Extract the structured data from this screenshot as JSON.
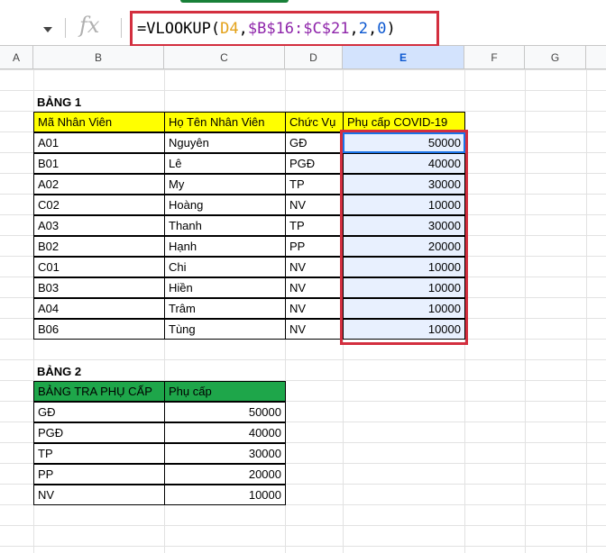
{
  "formula_bar": {
    "icon": "fx-icon",
    "formula_parts": [
      "=VLOOKUP(",
      "D4",
      ",",
      "$B$16:$C$21",
      ",",
      "2",
      ",",
      "0",
      ")"
    ]
  },
  "columns": [
    "A",
    "B",
    "C",
    "D",
    "E",
    "F",
    "G"
  ],
  "table1": {
    "title": "BẢNG 1",
    "headers": [
      "Mã Nhân Viên",
      "Họ Tên Nhân Viên",
      "Chức Vụ",
      "Phụ cấp COVID-19"
    ],
    "rows": [
      [
        "A01",
        "Nguyên",
        "GĐ",
        "50000"
      ],
      [
        "B01",
        "Lê",
        "PGĐ",
        "40000"
      ],
      [
        "A02",
        "My",
        "TP",
        "30000"
      ],
      [
        "C02",
        "Hoàng",
        "NV",
        "10000"
      ],
      [
        "A03",
        "Thanh",
        "TP",
        "30000"
      ],
      [
        "B02",
        "Hạnh",
        "PP",
        "20000"
      ],
      [
        "C01",
        "Chi",
        "NV",
        "10000"
      ],
      [
        "B03",
        "Hiền",
        "NV",
        "10000"
      ],
      [
        "A04",
        "Trâm",
        "NV",
        "10000"
      ],
      [
        "B06",
        "Tùng",
        "NV",
        "10000"
      ]
    ]
  },
  "table2": {
    "title": "BẢNG 2",
    "headers": [
      "BẢNG TRA PHỤ CẤP",
      "Phụ cấp"
    ],
    "rows": [
      [
        "GĐ",
        "50000"
      ],
      [
        "PGĐ",
        "40000"
      ],
      [
        "TP",
        "30000"
      ],
      [
        "PP",
        "20000"
      ],
      [
        "NV",
        "10000"
      ]
    ]
  },
  "colors": {
    "header_yellow": "#ffff00",
    "header_green": "#1ea64a",
    "highlight_red": "#d32f3f",
    "selection_blue": "#e8f0fe"
  }
}
